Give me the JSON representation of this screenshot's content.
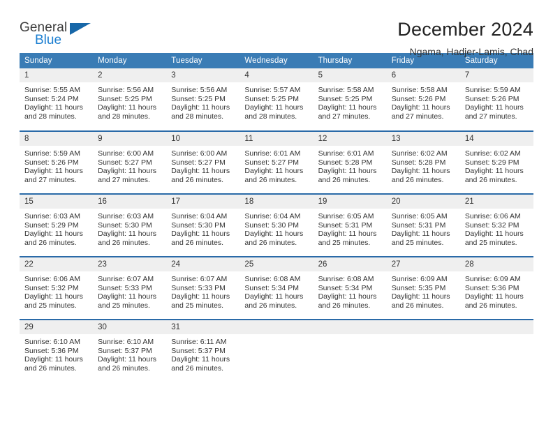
{
  "brand": {
    "name_part1": "General",
    "name_part2": "Blue",
    "flag_icon": "brand-flag-icon"
  },
  "header": {
    "month_title": "December 2024",
    "location": "Ngama, Hadjer-Lamis, Chad"
  },
  "theme": {
    "header_blue": "#3a7cb5",
    "row_rule_blue": "#2a6aa8",
    "daynum_band": "#efefef",
    "brand_blue": "#1c7fd1",
    "text": "#333333"
  },
  "calendar": {
    "weekday_headers": [
      "Sunday",
      "Monday",
      "Tuesday",
      "Wednesday",
      "Thursday",
      "Friday",
      "Saturday"
    ],
    "weeks": [
      [
        {
          "day": "1",
          "sunrise": "Sunrise: 5:55 AM",
          "sunset": "Sunset: 5:24 PM",
          "daylight_line1": "Daylight: 11 hours",
          "daylight_line2": "and 28 minutes."
        },
        {
          "day": "2",
          "sunrise": "Sunrise: 5:56 AM",
          "sunset": "Sunset: 5:25 PM",
          "daylight_line1": "Daylight: 11 hours",
          "daylight_line2": "and 28 minutes."
        },
        {
          "day": "3",
          "sunrise": "Sunrise: 5:56 AM",
          "sunset": "Sunset: 5:25 PM",
          "daylight_line1": "Daylight: 11 hours",
          "daylight_line2": "and 28 minutes."
        },
        {
          "day": "4",
          "sunrise": "Sunrise: 5:57 AM",
          "sunset": "Sunset: 5:25 PM",
          "daylight_line1": "Daylight: 11 hours",
          "daylight_line2": "and 28 minutes."
        },
        {
          "day": "5",
          "sunrise": "Sunrise: 5:58 AM",
          "sunset": "Sunset: 5:25 PM",
          "daylight_line1": "Daylight: 11 hours",
          "daylight_line2": "and 27 minutes."
        },
        {
          "day": "6",
          "sunrise": "Sunrise: 5:58 AM",
          "sunset": "Sunset: 5:26 PM",
          "daylight_line1": "Daylight: 11 hours",
          "daylight_line2": "and 27 minutes."
        },
        {
          "day": "7",
          "sunrise": "Sunrise: 5:59 AM",
          "sunset": "Sunset: 5:26 PM",
          "daylight_line1": "Daylight: 11 hours",
          "daylight_line2": "and 27 minutes."
        }
      ],
      [
        {
          "day": "8",
          "sunrise": "Sunrise: 5:59 AM",
          "sunset": "Sunset: 5:26 PM",
          "daylight_line1": "Daylight: 11 hours",
          "daylight_line2": "and 27 minutes."
        },
        {
          "day": "9",
          "sunrise": "Sunrise: 6:00 AM",
          "sunset": "Sunset: 5:27 PM",
          "daylight_line1": "Daylight: 11 hours",
          "daylight_line2": "and 27 minutes."
        },
        {
          "day": "10",
          "sunrise": "Sunrise: 6:00 AM",
          "sunset": "Sunset: 5:27 PM",
          "daylight_line1": "Daylight: 11 hours",
          "daylight_line2": "and 26 minutes."
        },
        {
          "day": "11",
          "sunrise": "Sunrise: 6:01 AM",
          "sunset": "Sunset: 5:27 PM",
          "daylight_line1": "Daylight: 11 hours",
          "daylight_line2": "and 26 minutes."
        },
        {
          "day": "12",
          "sunrise": "Sunrise: 6:01 AM",
          "sunset": "Sunset: 5:28 PM",
          "daylight_line1": "Daylight: 11 hours",
          "daylight_line2": "and 26 minutes."
        },
        {
          "day": "13",
          "sunrise": "Sunrise: 6:02 AM",
          "sunset": "Sunset: 5:28 PM",
          "daylight_line1": "Daylight: 11 hours",
          "daylight_line2": "and 26 minutes."
        },
        {
          "day": "14",
          "sunrise": "Sunrise: 6:02 AM",
          "sunset": "Sunset: 5:29 PM",
          "daylight_line1": "Daylight: 11 hours",
          "daylight_line2": "and 26 minutes."
        }
      ],
      [
        {
          "day": "15",
          "sunrise": "Sunrise: 6:03 AM",
          "sunset": "Sunset: 5:29 PM",
          "daylight_line1": "Daylight: 11 hours",
          "daylight_line2": "and 26 minutes."
        },
        {
          "day": "16",
          "sunrise": "Sunrise: 6:03 AM",
          "sunset": "Sunset: 5:30 PM",
          "daylight_line1": "Daylight: 11 hours",
          "daylight_line2": "and 26 minutes."
        },
        {
          "day": "17",
          "sunrise": "Sunrise: 6:04 AM",
          "sunset": "Sunset: 5:30 PM",
          "daylight_line1": "Daylight: 11 hours",
          "daylight_line2": "and 26 minutes."
        },
        {
          "day": "18",
          "sunrise": "Sunrise: 6:04 AM",
          "sunset": "Sunset: 5:30 PM",
          "daylight_line1": "Daylight: 11 hours",
          "daylight_line2": "and 26 minutes."
        },
        {
          "day": "19",
          "sunrise": "Sunrise: 6:05 AM",
          "sunset": "Sunset: 5:31 PM",
          "daylight_line1": "Daylight: 11 hours",
          "daylight_line2": "and 25 minutes."
        },
        {
          "day": "20",
          "sunrise": "Sunrise: 6:05 AM",
          "sunset": "Sunset: 5:31 PM",
          "daylight_line1": "Daylight: 11 hours",
          "daylight_line2": "and 25 minutes."
        },
        {
          "day": "21",
          "sunrise": "Sunrise: 6:06 AM",
          "sunset": "Sunset: 5:32 PM",
          "daylight_line1": "Daylight: 11 hours",
          "daylight_line2": "and 25 minutes."
        }
      ],
      [
        {
          "day": "22",
          "sunrise": "Sunrise: 6:06 AM",
          "sunset": "Sunset: 5:32 PM",
          "daylight_line1": "Daylight: 11 hours",
          "daylight_line2": "and 25 minutes."
        },
        {
          "day": "23",
          "sunrise": "Sunrise: 6:07 AM",
          "sunset": "Sunset: 5:33 PM",
          "daylight_line1": "Daylight: 11 hours",
          "daylight_line2": "and 25 minutes."
        },
        {
          "day": "24",
          "sunrise": "Sunrise: 6:07 AM",
          "sunset": "Sunset: 5:33 PM",
          "daylight_line1": "Daylight: 11 hours",
          "daylight_line2": "and 25 minutes."
        },
        {
          "day": "25",
          "sunrise": "Sunrise: 6:08 AM",
          "sunset": "Sunset: 5:34 PM",
          "daylight_line1": "Daylight: 11 hours",
          "daylight_line2": "and 26 minutes."
        },
        {
          "day": "26",
          "sunrise": "Sunrise: 6:08 AM",
          "sunset": "Sunset: 5:34 PM",
          "daylight_line1": "Daylight: 11 hours",
          "daylight_line2": "and 26 minutes."
        },
        {
          "day": "27",
          "sunrise": "Sunrise: 6:09 AM",
          "sunset": "Sunset: 5:35 PM",
          "daylight_line1": "Daylight: 11 hours",
          "daylight_line2": "and 26 minutes."
        },
        {
          "day": "28",
          "sunrise": "Sunrise: 6:09 AM",
          "sunset": "Sunset: 5:36 PM",
          "daylight_line1": "Daylight: 11 hours",
          "daylight_line2": "and 26 minutes."
        }
      ],
      [
        {
          "day": "29",
          "sunrise": "Sunrise: 6:10 AM",
          "sunset": "Sunset: 5:36 PM",
          "daylight_line1": "Daylight: 11 hours",
          "daylight_line2": "and 26 minutes."
        },
        {
          "day": "30",
          "sunrise": "Sunrise: 6:10 AM",
          "sunset": "Sunset: 5:37 PM",
          "daylight_line1": "Daylight: 11 hours",
          "daylight_line2": "and 26 minutes."
        },
        {
          "day": "31",
          "sunrise": "Sunrise: 6:11 AM",
          "sunset": "Sunset: 5:37 PM",
          "daylight_line1": "Daylight: 11 hours",
          "daylight_line2": "and 26 minutes."
        },
        {
          "day": "",
          "sunrise": "",
          "sunset": "",
          "daylight_line1": "",
          "daylight_line2": ""
        },
        {
          "day": "",
          "sunrise": "",
          "sunset": "",
          "daylight_line1": "",
          "daylight_line2": ""
        },
        {
          "day": "",
          "sunrise": "",
          "sunset": "",
          "daylight_line1": "",
          "daylight_line2": ""
        },
        {
          "day": "",
          "sunrise": "",
          "sunset": "",
          "daylight_line1": "",
          "daylight_line2": ""
        }
      ]
    ]
  }
}
